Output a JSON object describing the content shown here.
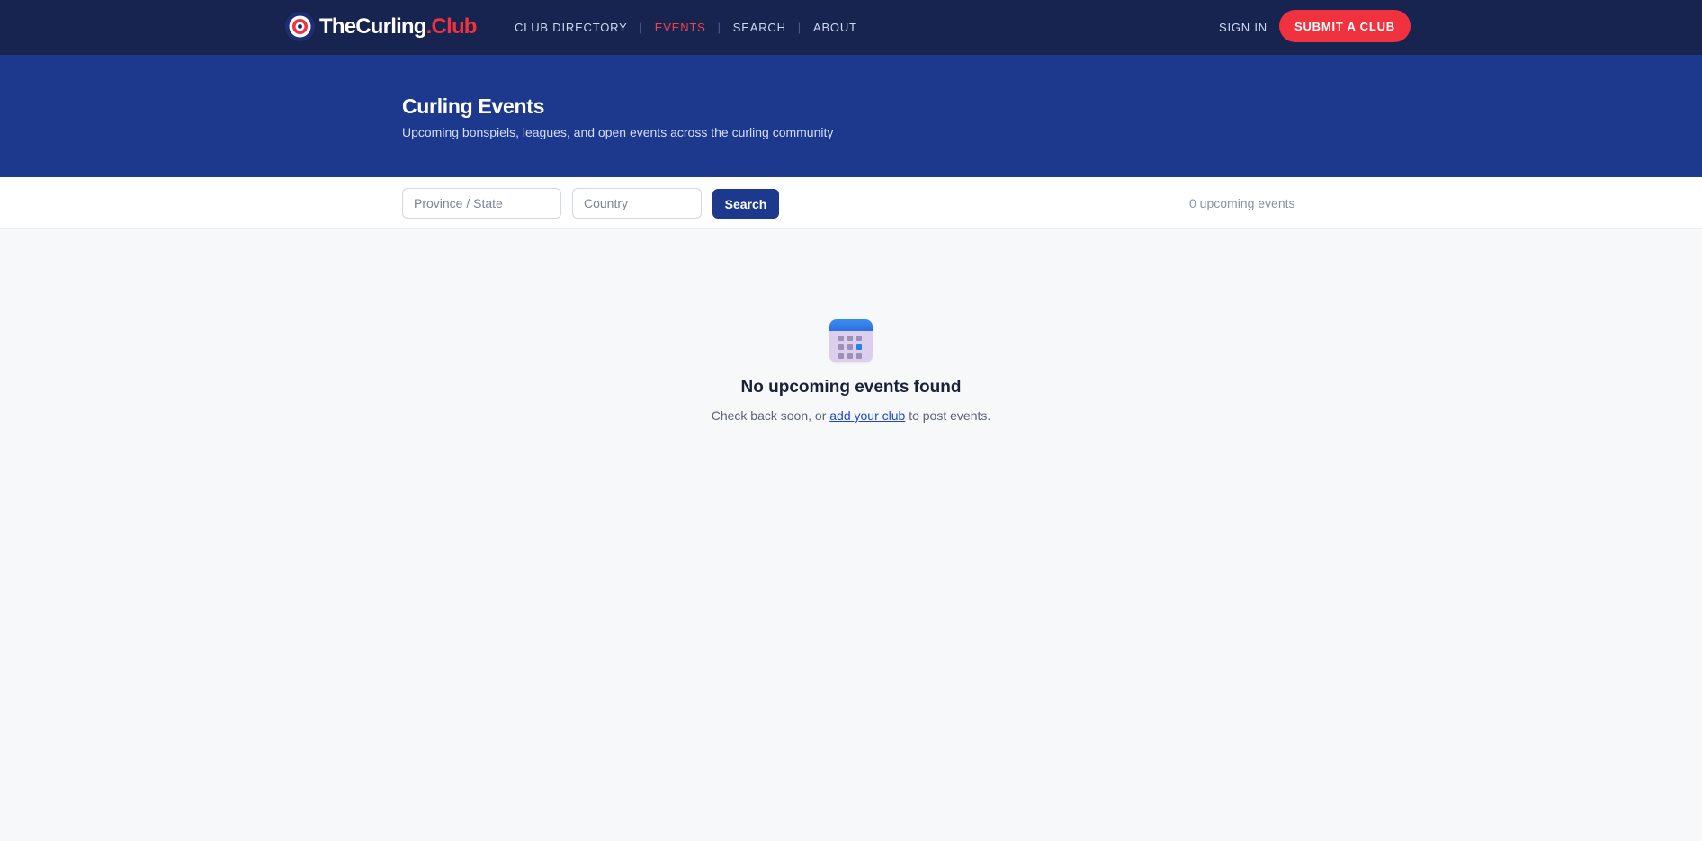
{
  "nav": {
    "logo_main": "TheCurling",
    "logo_accent": ".Club",
    "links": [
      {
        "label": "CLUB DIRECTORY",
        "active": false
      },
      {
        "label": "EVENTS",
        "active": true
      },
      {
        "label": "SEARCH",
        "active": false
      },
      {
        "label": "ABOUT",
        "active": false
      }
    ],
    "separator": "|",
    "sign_in": "SIGN IN",
    "submit": "SUBMIT A CLUB"
  },
  "hero": {
    "title": "Curling Events",
    "subtitle": "Upcoming bonspiels, leagues, and open events across the curling community"
  },
  "filters": {
    "province_placeholder": "Province / State",
    "country_placeholder": "Country",
    "search_label": "Search",
    "count_text": "0 upcoming events"
  },
  "empty_state": {
    "icon": "calendar-icon",
    "title": "No upcoming events found",
    "text_before": "Check back soon, or ",
    "link_text": "add your club",
    "text_after": " to post events."
  },
  "colors": {
    "nav_bg": "#17244f",
    "hero_bg": "#1d398e",
    "accent_red": "#f0323f",
    "page_bg": "#f7f8fa"
  }
}
